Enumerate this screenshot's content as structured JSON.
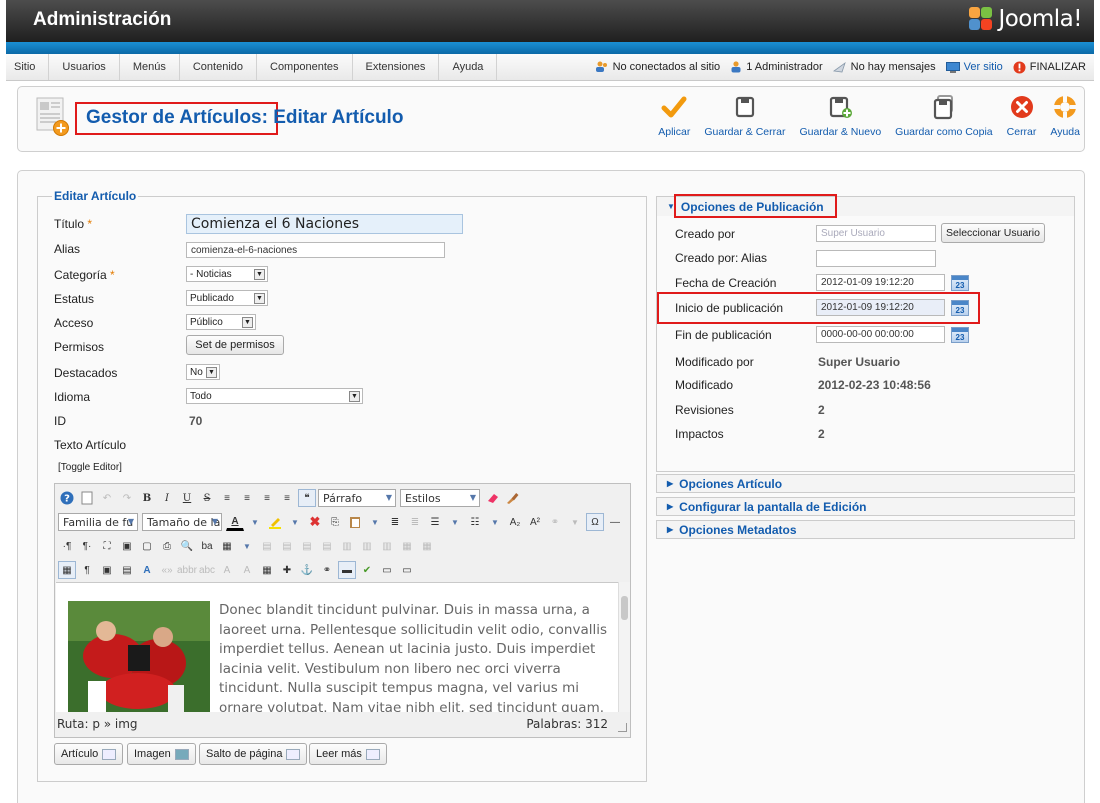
{
  "header": {
    "title": "Administración",
    "logo_text": "Joomla!"
  },
  "menu": {
    "items": [
      "Sitio",
      "Usuarios",
      "Menús",
      "Contenido",
      "Componentes",
      "Extensiones",
      "Ayuda"
    ],
    "status": {
      "not_connected": "No conectados al sitio",
      "admins": "1 Administrador",
      "messages": "No hay mensajes",
      "view_site": "Ver sitio",
      "logout": "FINALIZAR"
    }
  },
  "toolbar": {
    "title_main": "Gestor de Artículos",
    "title_sub": ": Editar Artículo",
    "buttons": {
      "apply": "Aplicar",
      "save_close": "Guardar & Cerrar",
      "save_new": "Guardar & Nuevo",
      "save_copy": "Guardar como Copia",
      "close": "Cerrar",
      "help": "Ayuda"
    }
  },
  "edit": {
    "legend": "Editar Artículo",
    "labels": {
      "title": "Título",
      "alias": "Alias",
      "category": "Categoría",
      "status": "Estatus",
      "access": "Acceso",
      "permissions": "Permisos",
      "featured": "Destacados",
      "language": "Idioma",
      "id": "ID",
      "text": "Texto Artículo"
    },
    "required_mark": "*",
    "values": {
      "title": "Comienza el 6 Naciones",
      "alias": "comienza-el-6-naciones",
      "category": "- Noticias",
      "status": "Publicado",
      "access": "Público",
      "permissions_button": "Set de permisos",
      "featured": "No",
      "language": "Todo",
      "id": "70"
    },
    "toggle_editor": "[Toggle Editor]",
    "editor": {
      "format_select": "Párrafo",
      "styles_select": "Estilos",
      "font_family": "Familia de fu",
      "font_size": "Tamaño de la",
      "content": "Donec blandit tincidunt pulvinar. Duis in massa urna, a laoreet urna. Pellentesque sollicitudin velit odio, convallis imperdiet tellus. Aenean ut lacinia justo. Duis imperdiet lacinia velit. Vestibulum non libero nec orci viverra tincidunt. Nulla suscipit tempus magna, vel varius mi ornare volutpat. Nam vitae nibh elit, sed tincidunt quam. In ac sagittis nisl.",
      "path": "Ruta: p » img",
      "words": "Palabras: 312"
    },
    "bottom_buttons": {
      "article": "Artículo",
      "image": "Imagen",
      "page_break": "Salto de página",
      "read_more": "Leer más"
    }
  },
  "publishing": {
    "header": "Opciones de Publicación",
    "created_by_label": "Creado por",
    "created_by_placeholder": "Super Usuario",
    "select_user_button": "Seleccionar Usuario",
    "created_alias_label": "Creado por: Alias",
    "created_date_label": "Fecha de Creación",
    "created_date": "2012-01-09 19:12:20",
    "publish_up_label": "Inicio de publicación",
    "publish_up": "2012-01-09 19:12:20",
    "publish_down_label": "Fin de publicación",
    "publish_down": "0000-00-00 00:00:00",
    "modified_by_label": "Modificado por",
    "modified_by": "Super Usuario",
    "modified_label": "Modificado",
    "modified": "2012-02-23 10:48:56",
    "revisions_label": "Revisiones",
    "revisions": "2",
    "hits_label": "Impactos",
    "hits": "2",
    "calendar_day": "23"
  },
  "collapsed_panels": [
    "Opciones Artículo",
    "Configurar la pantalla de Edición",
    "Opciones Metadatos"
  ],
  "colors": {
    "accent": "#135cae",
    "header": "#2d2d2d",
    "strip": "#1380c7",
    "highlight": "#e01a1a"
  }
}
